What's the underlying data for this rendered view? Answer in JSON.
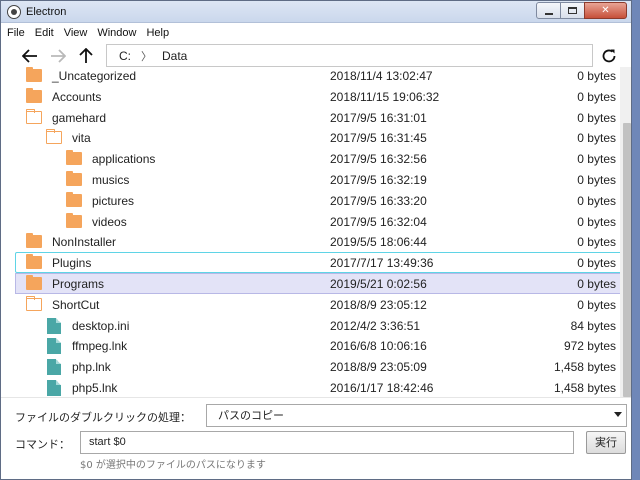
{
  "window": {
    "title": "Electron"
  },
  "colors": {
    "folder": "#f5a55c",
    "file": "#4aa7a6",
    "selection_outline": "#5fd4e6",
    "selection_fill": "#e3e3f7"
  },
  "menu": [
    "File",
    "Edit",
    "View",
    "Window",
    "Help"
  ],
  "nav": {
    "back_icon": "arrow-left-icon",
    "forward_icon": "arrow-right-icon",
    "up_icon": "arrow-up-icon",
    "refresh_icon": "refresh-icon",
    "path": [
      "C:",
      "Data"
    ],
    "separator": "〉"
  },
  "files": [
    {
      "name": "_Uncategorized",
      "date": "2018/11/4 13:02:47",
      "size": "0 bytes",
      "type": "folder",
      "depth": 0
    },
    {
      "name": "Accounts",
      "date": "2018/11/15 19:06:32",
      "size": "0 bytes",
      "type": "folder",
      "depth": 0
    },
    {
      "name": "gamehard",
      "date": "2017/9/5 16:31:01",
      "size": "0 bytes",
      "type": "folder-open",
      "depth": 0
    },
    {
      "name": "vita",
      "date": "2017/9/5 16:31:45",
      "size": "0 bytes",
      "type": "folder-open",
      "depth": 1
    },
    {
      "name": "applications",
      "date": "2017/9/5 16:32:56",
      "size": "0 bytes",
      "type": "folder",
      "depth": 2
    },
    {
      "name": "musics",
      "date": "2017/9/5 16:32:19",
      "size": "0 bytes",
      "type": "folder",
      "depth": 2
    },
    {
      "name": "pictures",
      "date": "2017/9/5 16:33:20",
      "size": "0 bytes",
      "type": "folder",
      "depth": 2
    },
    {
      "name": "videos",
      "date": "2017/9/5 16:32:04",
      "size": "0 bytes",
      "type": "folder",
      "depth": 2
    },
    {
      "name": "NonInstaller",
      "date": "2019/5/5 18:06:44",
      "size": "0 bytes",
      "type": "folder",
      "depth": 0
    },
    {
      "name": "Plugins",
      "date": "2017/7/17 13:49:36",
      "size": "0 bytes",
      "type": "folder",
      "depth": 0,
      "state": "focused"
    },
    {
      "name": "Programs",
      "date": "2019/5/21 0:02:56",
      "size": "0 bytes",
      "type": "folder",
      "depth": 0,
      "state": "selected"
    },
    {
      "name": "ShortCut",
      "date": "2018/8/9 23:05:12",
      "size": "0 bytes",
      "type": "folder-open",
      "depth": 0
    },
    {
      "name": "desktop.ini",
      "date": "2012/4/2 3:36:51",
      "size": "84 bytes",
      "type": "file",
      "depth": 1
    },
    {
      "name": "ffmpeg.lnk",
      "date": "2016/6/8 10:06:16",
      "size": "972 bytes",
      "type": "file",
      "depth": 1
    },
    {
      "name": "php.lnk",
      "date": "2018/8/9 23:05:09",
      "size": "1,458 bytes",
      "type": "file",
      "depth": 1
    },
    {
      "name": "php5.lnk",
      "date": "2016/1/17 18:42:46",
      "size": "1,458 bytes",
      "type": "file",
      "depth": 1
    }
  ],
  "bottom": {
    "dblclick_label": "ファイルのダブルクリックの処理：",
    "dblclick_value": "パスのコピー",
    "command_label": "コマンド：",
    "command_value": "start $0",
    "run_label": "実行",
    "hint": "$0 が選択中のファイルのパスになります"
  }
}
